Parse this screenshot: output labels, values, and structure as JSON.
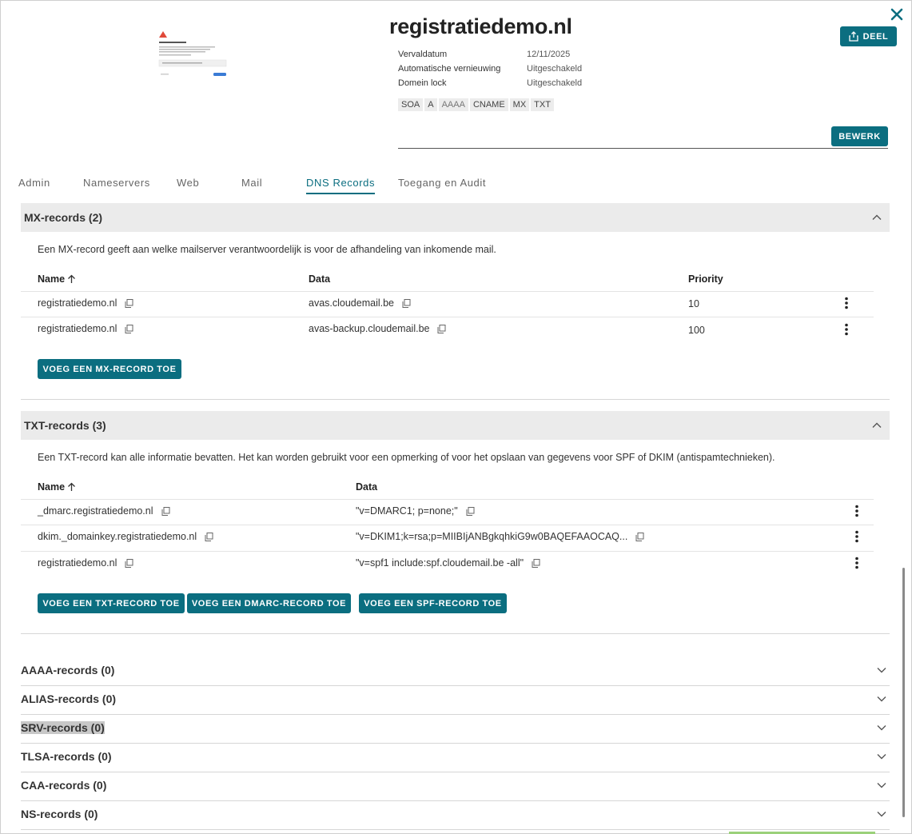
{
  "header": {
    "domain": "registratiedemo.nl",
    "share_label": "DEEL",
    "edit_label": "BEWERK",
    "info": [
      {
        "label": "Vervaldatum",
        "value": "12/11/2025"
      },
      {
        "label": "Automatische vernieuwing",
        "value": "Uitgeschakeld"
      },
      {
        "label": "Domein lock",
        "value": "Uitgeschakeld"
      }
    ],
    "record_tags": [
      "SOA",
      "A",
      "AAAA",
      "CNAME",
      "MX",
      "TXT"
    ]
  },
  "tabs": [
    "Admin",
    "Nameservers",
    "Web",
    "Mail",
    "DNS Records",
    "Toegang en Audit"
  ],
  "active_tab": "DNS Records",
  "mx": {
    "title": "MX-records (2)",
    "description": "Een MX-record geeft aan welke mailserver verantwoordelijk is voor de afhandeling van inkomende mail.",
    "columns": [
      "Name",
      "Data",
      "Priority"
    ],
    "rows": [
      {
        "name": "registratiedemo.nl",
        "data": "avas.cloudemail.be",
        "priority": "10"
      },
      {
        "name": "registratiedemo.nl",
        "data": "avas-backup.cloudemail.be",
        "priority": "100"
      }
    ],
    "add_label": "VOEG EEN MX-RECORD TOE"
  },
  "txt": {
    "title": "TXT-records (3)",
    "description": "Een TXT-record kan alle informatie bevatten. Het kan worden gebruikt voor een opmerking of voor het opslaan van gegevens voor SPF of DKIM (antispamtechnieken).",
    "columns": [
      "Name",
      "Data"
    ],
    "rows": [
      {
        "name": "_dmarc.registratiedemo.nl",
        "data": "\"v=DMARC1; p=none;\""
      },
      {
        "name": "dkim._domainkey.registratiedemo.nl",
        "data": "\"v=DKIM1;k=rsa;p=MIIBIjANBgkqhkiG9w0BAQEFAAOCAQ..."
      },
      {
        "name": "registratiedemo.nl",
        "data": "\"v=spf1 include:spf.cloudemail.be -all\""
      }
    ],
    "add_txt_label": "VOEG EEN TXT-RECORD TOE",
    "add_dmarc_label": "VOEG EEN DMARC-RECORD TOE",
    "add_spf_label": "VOEG EEN SPF-RECORD TOE"
  },
  "collapsed": [
    "AAAA-records (0)",
    "ALIAS-records (0)",
    "SRV-records (0)",
    "TLSA-records (0)",
    "CAA-records (0)",
    "NS-records (0)"
  ],
  "colors": {
    "accent": "#0b6e80",
    "section_bg": "#ebebeb"
  }
}
